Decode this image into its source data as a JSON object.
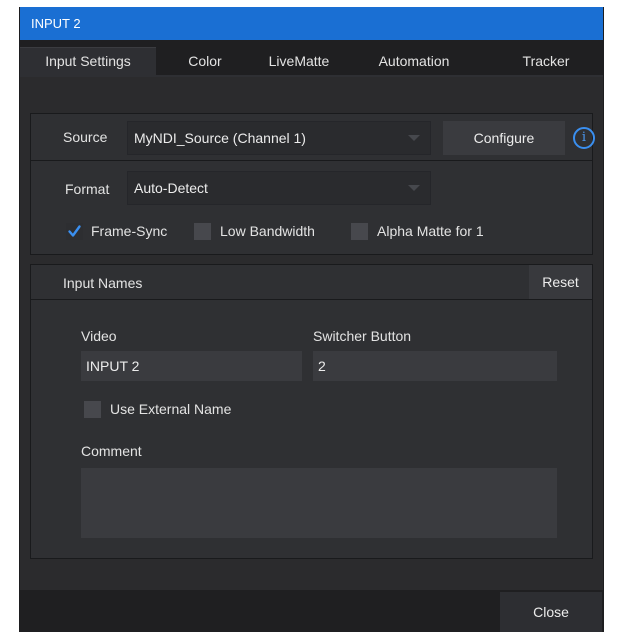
{
  "window": {
    "title": "INPUT 2"
  },
  "tabs": [
    {
      "label": "Input Settings",
      "active": true
    },
    {
      "label": "Color"
    },
    {
      "label": "LiveMatte"
    },
    {
      "label": "Automation"
    },
    {
      "label": "Tracker"
    }
  ],
  "source": {
    "label": "Source",
    "value": "MyNDI_Source (Channel 1)",
    "configure_label": "Configure",
    "info_glyph": "i"
  },
  "format": {
    "label": "Format",
    "value": "Auto-Detect"
  },
  "options": {
    "frame_sync": {
      "label": "Frame-Sync",
      "checked": true
    },
    "low_bandwidth": {
      "label": "Low Bandwidth",
      "checked": false
    },
    "alpha_matte": {
      "label": "Alpha Matte for 1",
      "checked": false
    }
  },
  "input_names": {
    "header": "Input Names",
    "reset_label": "Reset",
    "video_label": "Video",
    "video_value": "INPUT 2",
    "switcher_label": "Switcher Button",
    "switcher_value": "2",
    "use_external_label": "Use External Name",
    "comment_label": "Comment",
    "comment_value": ""
  },
  "footer": {
    "close_label": "Close"
  },
  "colors": {
    "accent": "#1a6fd3",
    "check": "#3a8ff0"
  }
}
